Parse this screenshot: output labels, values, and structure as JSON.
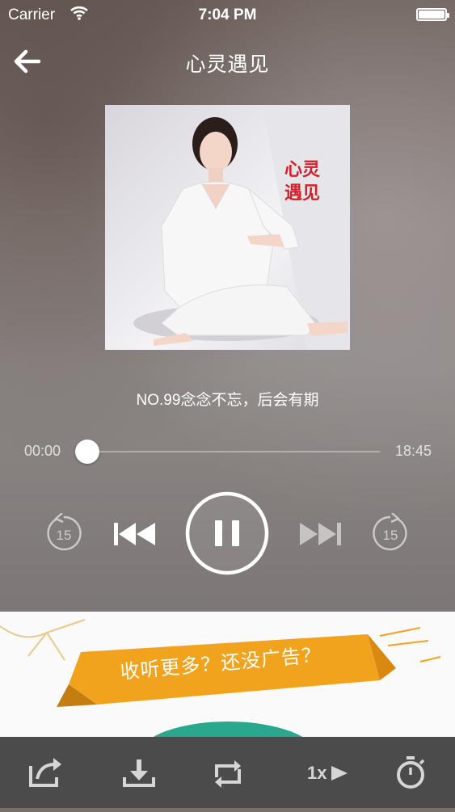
{
  "status_bar": {
    "carrier": "Carrier",
    "time": "7:04 PM",
    "battery_level": 1.0
  },
  "header": {
    "title": "心灵遇见",
    "back_icon": "arrow-left-icon"
  },
  "album": {
    "cover_text_line1": "心灵",
    "cover_text_line2": "遇见",
    "accent_color": "#d0222a"
  },
  "track": {
    "title": "NO.99念念不忘，后会有期"
  },
  "progress": {
    "current": "00:00",
    "total": "18:45",
    "fraction": 0.0
  },
  "controls": {
    "rewind_icon": "rewind-15-icon",
    "rewind_seconds": "15",
    "previous_icon": "skip-previous-icon",
    "pause_icon": "pause-icon",
    "next_icon": "skip-next-icon",
    "forward_icon": "forward-15-icon",
    "forward_seconds": "15"
  },
  "banner": {
    "text": "收听更多？还没广告？",
    "ribbon_color": "#f2a31d",
    "circle_color": "#2aa88e"
  },
  "toolbar": {
    "items": [
      {
        "icon": "share-icon"
      },
      {
        "icon": "download-icon"
      },
      {
        "icon": "repeat-icon"
      },
      {
        "icon": "speed-icon",
        "label": "1x"
      },
      {
        "icon": "timer-icon"
      }
    ]
  }
}
